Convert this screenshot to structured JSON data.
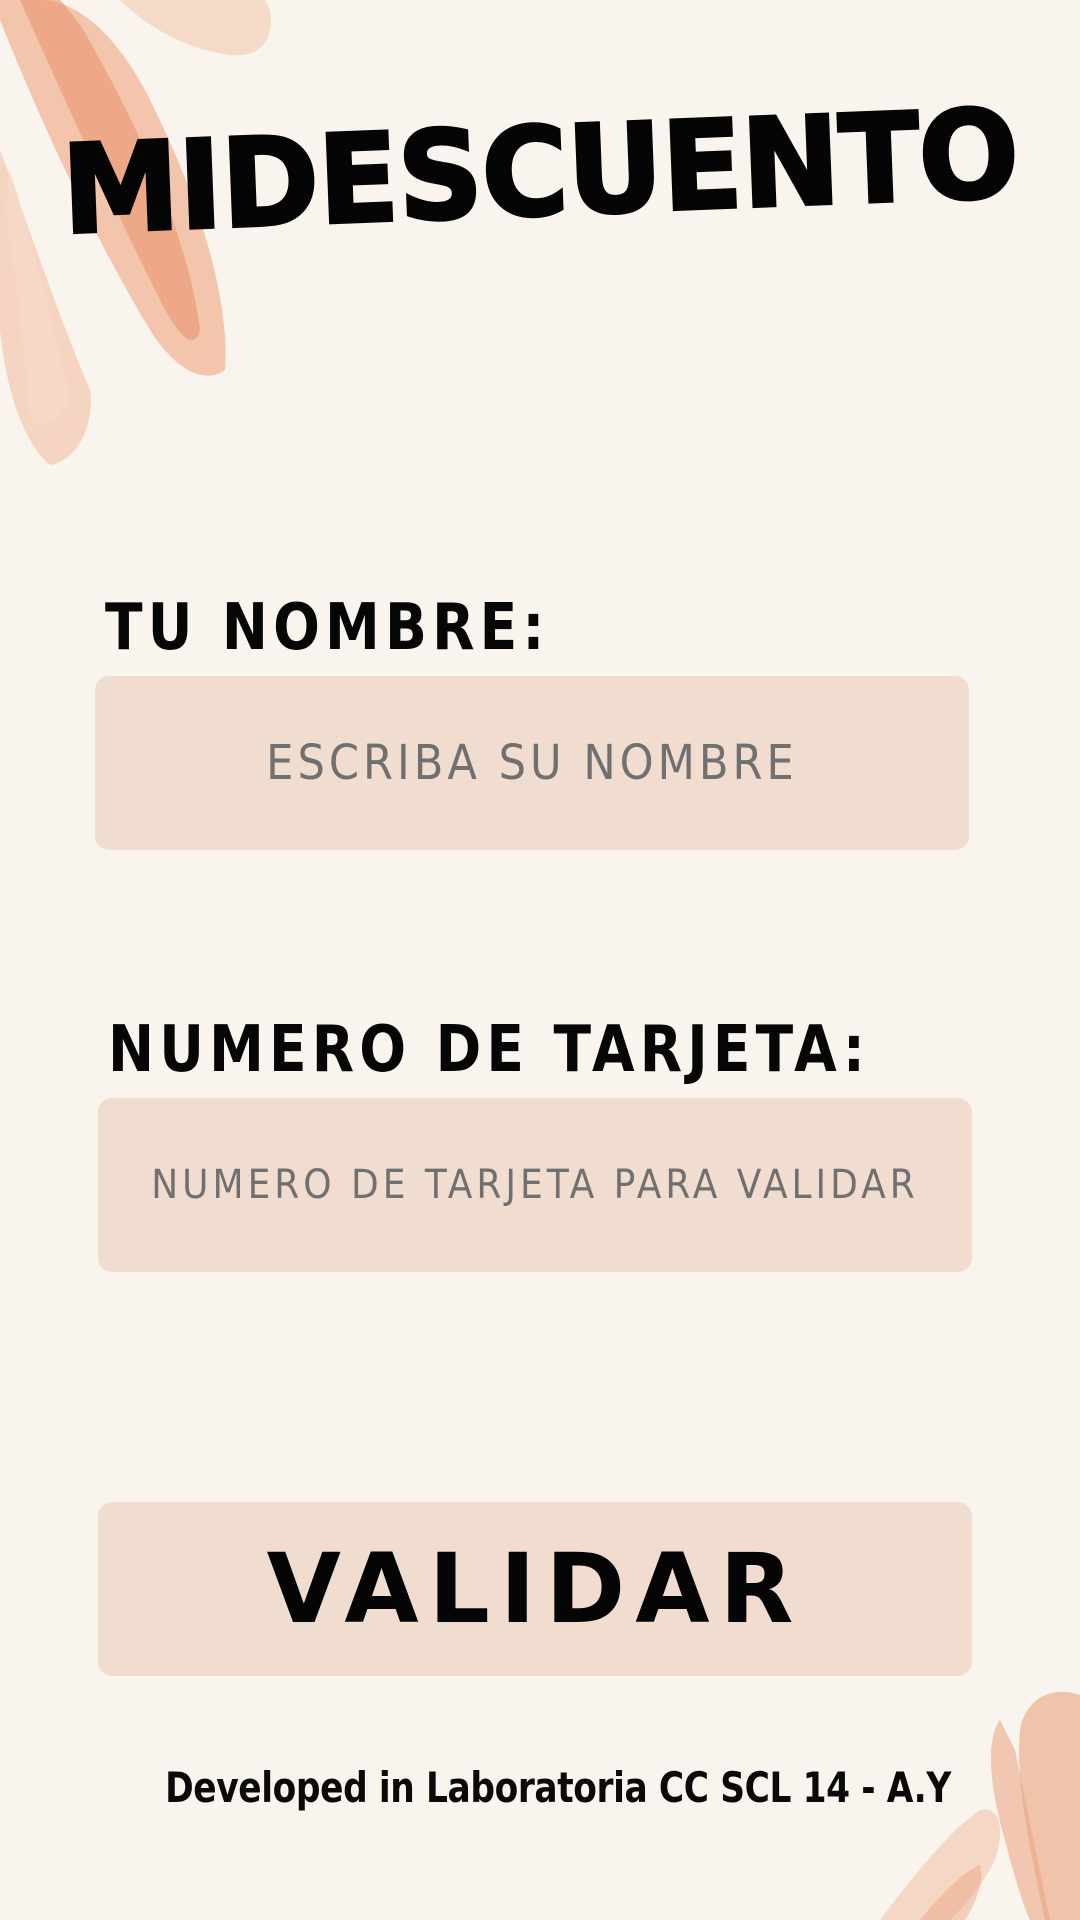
{
  "app": {
    "title": "MIDESCUENTO"
  },
  "form": {
    "name_label": "TU NOMBRE:",
    "name_placeholder": "ESCRIBA SU NOMBRE",
    "card_label": "NUMERO DE TARJETA:",
    "card_placeholder": "NUMERO DE TARJETA PARA VALIDAR",
    "submit_label": "VALIDAR"
  },
  "footer": {
    "credit": "Developed in Laboratoria CC SCL 14 - A.Y"
  },
  "colors": {
    "background": "#f9f4ee",
    "field_fill": "#f1ddd0",
    "text": "#050505",
    "placeholder": "#707070",
    "brush_accent": "#eaa07f"
  }
}
